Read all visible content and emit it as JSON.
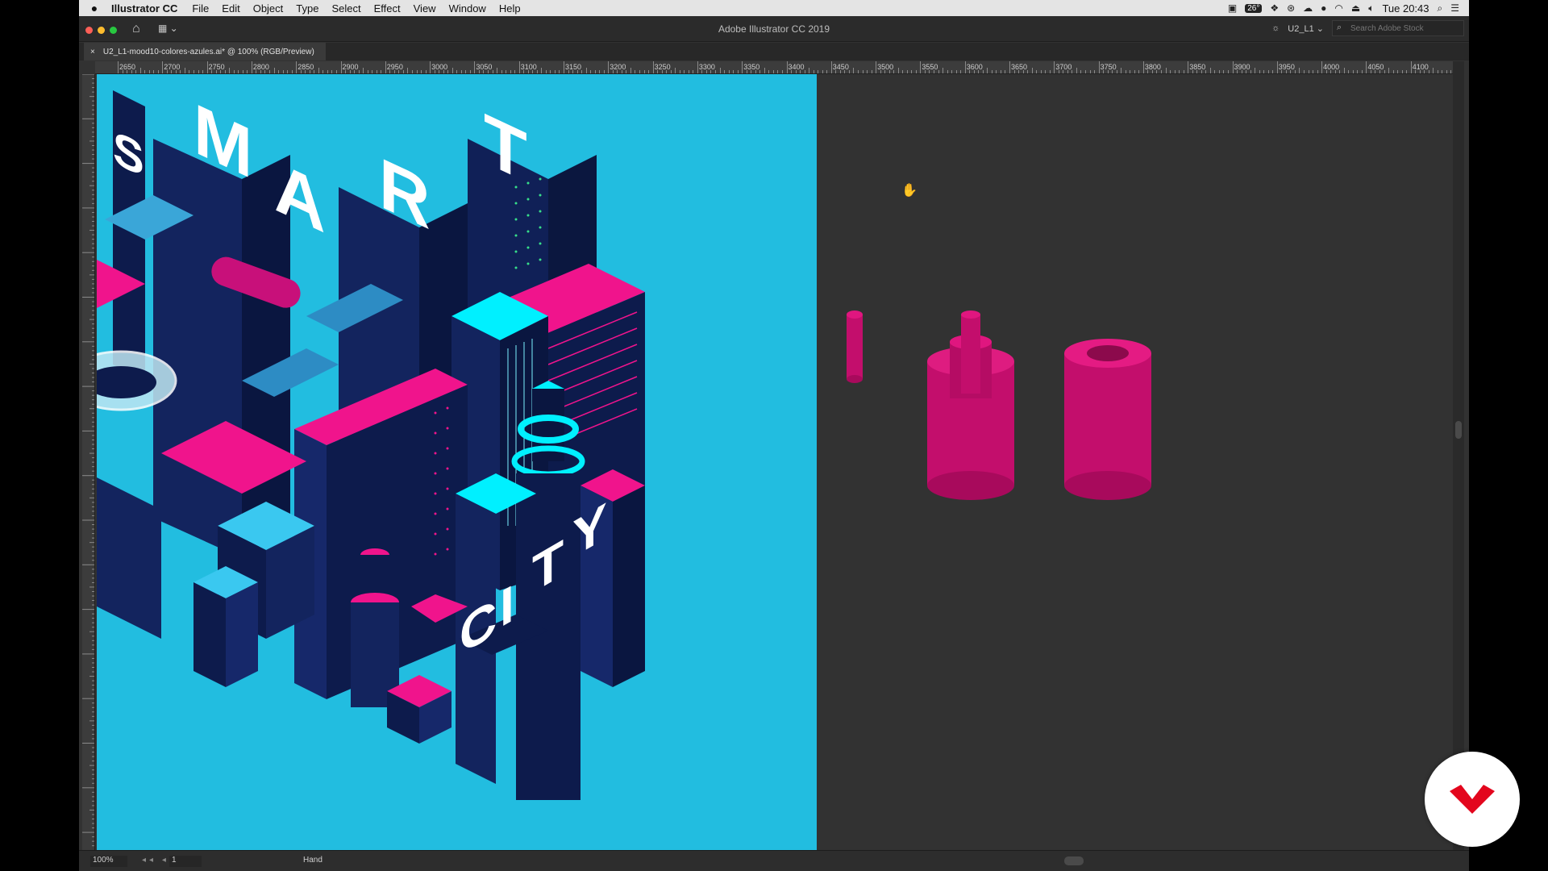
{
  "menubar": {
    "app_name": "Illustrator CC",
    "items": [
      "File",
      "Edit",
      "Object",
      "Type",
      "Select",
      "Effect",
      "View",
      "Window",
      "Help"
    ],
    "temperature": "26°",
    "clock": "Tue 20:43"
  },
  "titlebar": {
    "title": "Adobe Illustrator CC 2019",
    "workspace": "U2_L1",
    "search_placeholder": "Search Adobe Stock"
  },
  "document_tab": {
    "close": "×",
    "label": "U2_L1-mood10-colores-azules.ai* @ 100% (RGB/Preview)"
  },
  "ruler": {
    "labels": [
      "2650",
      "2700",
      "2750",
      "2800",
      "2850",
      "2900",
      "2950",
      "3000",
      "3050",
      "3100",
      "3150",
      "3200",
      "3250",
      "3300",
      "3350",
      "3400",
      "3450",
      "3500",
      "3550",
      "3600",
      "3650",
      "3700",
      "3750",
      "3800",
      "3850",
      "3900",
      "3950",
      "4000",
      "4050",
      "4100"
    ]
  },
  "artwork": {
    "title_letters": [
      "S",
      "M",
      "A",
      "R",
      "T"
    ],
    "subtitle_letters": [
      "C",
      "I",
      "T",
      "Y"
    ],
    "colors": {
      "background": "#22bde0",
      "magenta": "#f0148c",
      "navy": "#0d1b4c",
      "cyan": "#00f0ff"
    }
  },
  "statusbar": {
    "zoom": "100%",
    "artboard": "1",
    "tool": "Hand"
  },
  "icons": {
    "apple": "apple-icon",
    "home": "home-icon",
    "search": "search-icon",
    "hand": "hand-cursor-icon"
  }
}
